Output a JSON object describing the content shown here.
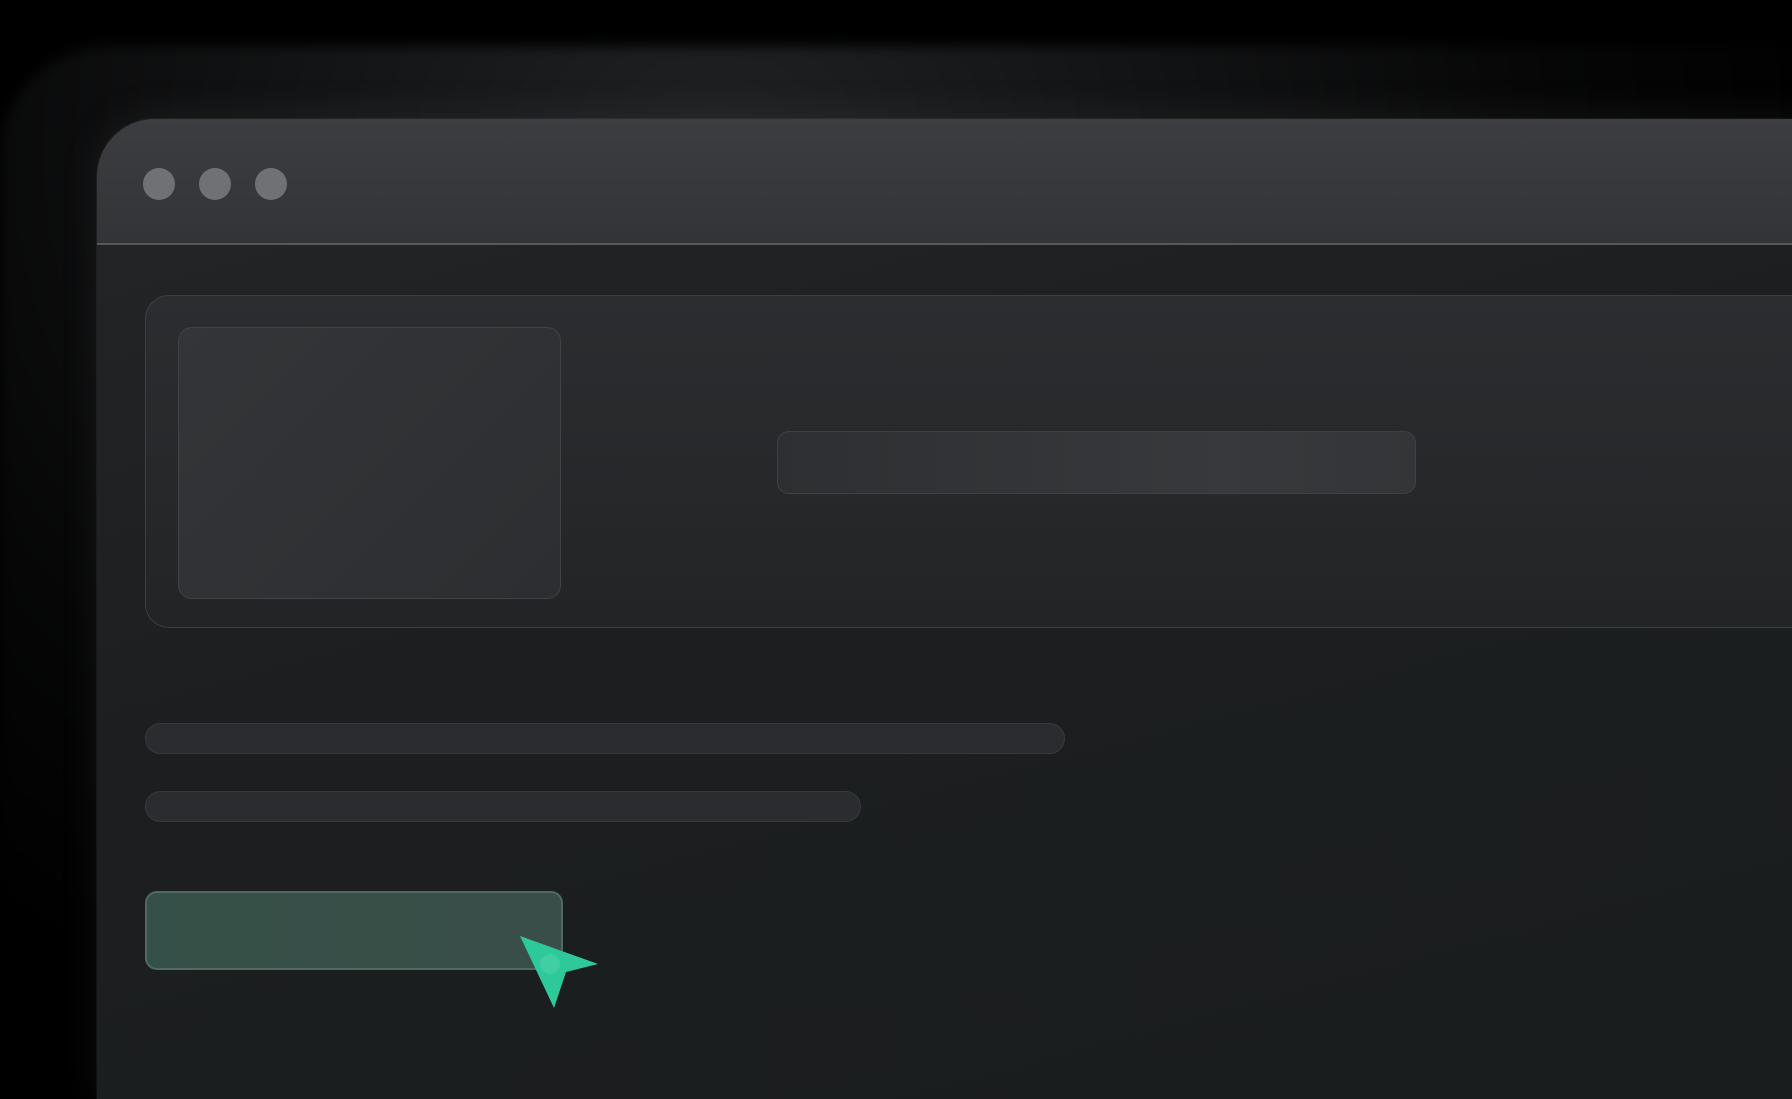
{
  "window": {
    "title_dots": [
      "window-dot-1",
      "window-dot-2",
      "window-dot-3"
    ]
  },
  "card": {
    "title": ""
  },
  "text_lines": [
    "",
    ""
  ],
  "action_button": {
    "label": ""
  },
  "colors": {
    "accent": "#2ec99a",
    "window_bg": "#1e2022",
    "titlebar_bg": "#37393c",
    "button_bg": "#375049"
  },
  "icons": {
    "cursor": "pointer-arrow-icon"
  }
}
